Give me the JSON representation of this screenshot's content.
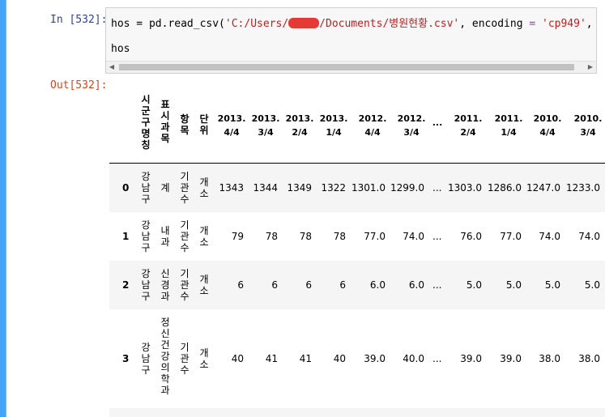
{
  "cells": [
    {
      "in_prompt": "In [532]:",
      "code": {
        "line1_part1": "hos = pd.read_csv(",
        "line1_str1a": "'C:/Users/",
        "line1_str1b": "/Documents/병원현황.csv'",
        "line1_mid": ", encoding ",
        "line1_eq": "=",
        "line1_sp": " ",
        "line1_str2": "'cp949'",
        "line1_tail": ", skipro",
        "line2": "hos"
      },
      "out_prompt": "Out[532]:"
    }
  ],
  "dataframe": {
    "columns": {
      "c1": "시군구명칭",
      "c2": "표시과목",
      "c3": "항목",
      "c4": "단위",
      "q1": {
        "l1": "2013.",
        "l2": "4/4"
      },
      "q2": {
        "l1": "2013.",
        "l2": "3/4"
      },
      "q3": {
        "l1": "2013.",
        "l2": "2/4"
      },
      "q4": {
        "l1": "2013.",
        "l2": "1/4"
      },
      "q5": {
        "l1": "2012.",
        "l2": "4/4"
      },
      "q6": {
        "l1": "2012.",
        "l2": "3/4"
      },
      "ellipsis": "...",
      "q7": {
        "l1": "2011.",
        "l2": "2/4"
      },
      "q8": {
        "l1": "2011.",
        "l2": "1/4"
      },
      "q9": {
        "l1": "2010.",
        "l2": "4/4"
      },
      "q10": {
        "l1": "2010.",
        "l2": "3/4"
      }
    },
    "rows": [
      {
        "idx": "0",
        "c1": "강남구",
        "c2": "계",
        "c3": "기관수",
        "c4": "개소",
        "v1": "1343",
        "v2": "1344",
        "v3": "1349",
        "v4": "1322",
        "v5": "1301.0",
        "v6": "1299.0",
        "ell": "...",
        "v7": "1303.0",
        "v8": "1286.0",
        "v9": "1247.0",
        "v10": "1233.0"
      },
      {
        "idx": "1",
        "c1": "강남구",
        "c2": "내과",
        "c3": "기관수",
        "c4": "개소",
        "v1": "79",
        "v2": "78",
        "v3": "78",
        "v4": "78",
        "v5": "77.0",
        "v6": "74.0",
        "ell": "...",
        "v7": "76.0",
        "v8": "77.0",
        "v9": "74.0",
        "v10": "74.0"
      },
      {
        "idx": "2",
        "c1": "강남구",
        "c2": "신경과",
        "c3": "기관수",
        "c4": "개소",
        "v1": "6",
        "v2": "6",
        "v3": "6",
        "v4": "6",
        "v5": "6.0",
        "v6": "6.0",
        "ell": "...",
        "v7": "5.0",
        "v8": "5.0",
        "v9": "5.0",
        "v10": "5.0"
      },
      {
        "idx": "3",
        "c1": "강남구",
        "c2": "정신건강의학과",
        "c3": "기관수",
        "c4": "개소",
        "v1": "40",
        "v2": "41",
        "v3": "41",
        "v4": "40",
        "v5": "39.0",
        "v6": "40.0",
        "ell": "...",
        "v7": "39.0",
        "v8": "39.0",
        "v9": "38.0",
        "v10": "38.0"
      }
    ]
  },
  "colors": {
    "accent": "#42a5f5",
    "in_prompt": "#303f9f",
    "out_prompt": "#d84315",
    "redaction": "#e53935"
  }
}
